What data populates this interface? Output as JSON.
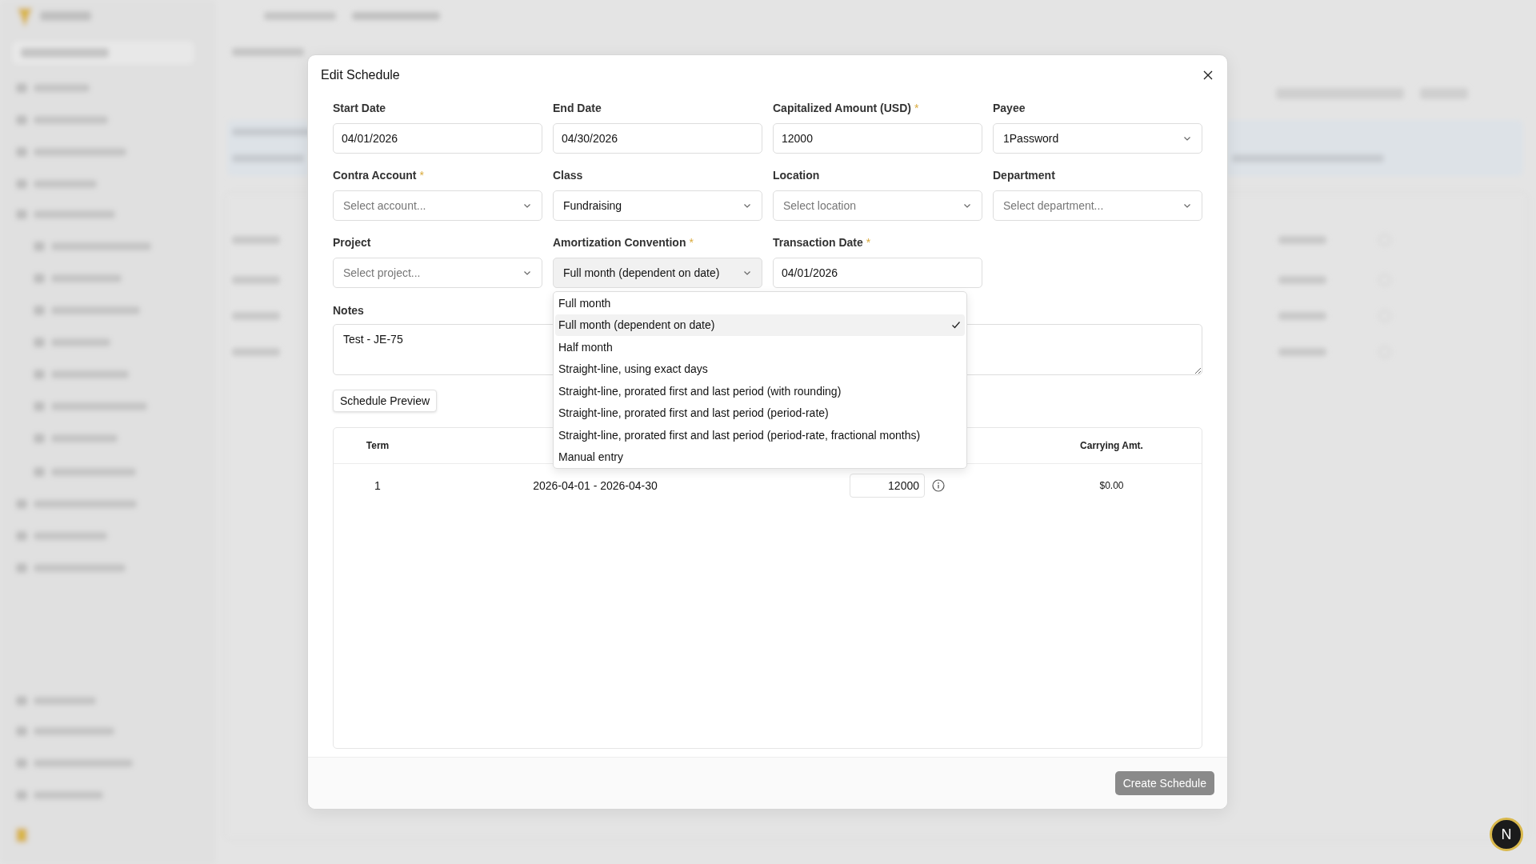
{
  "dialog": {
    "title": "Edit Schedule",
    "fields": [
      {
        "label": "Start Date",
        "kind": "text",
        "value": "04/01/2026"
      },
      {
        "label": "End Date",
        "kind": "text",
        "value": "04/30/2026"
      },
      {
        "label": "Capitalized Amount (USD)",
        "required_mark": "*",
        "kind": "text",
        "value": "12000"
      },
      {
        "label": "Payee",
        "kind": "select",
        "value": "1Password"
      },
      {
        "label": "Contra Account",
        "required_mark": "*",
        "kind": "select",
        "placeholder": "Select account..."
      },
      {
        "label": "Class",
        "kind": "select",
        "value": "Fundraising"
      },
      {
        "label": "Location",
        "kind": "select",
        "placeholder": "Select location"
      },
      {
        "label": "Department",
        "kind": "select",
        "placeholder": "Select department..."
      },
      {
        "label": "Project",
        "kind": "select",
        "placeholder": "Select project..."
      },
      {
        "label": "Amortization Convention",
        "required_mark": "*",
        "kind": "select",
        "value": "Full month (dependent on date)",
        "open": true,
        "options": [
          {
            "label": "Full month",
            "selected": false
          },
          {
            "label": "Full month (dependent on date)",
            "selected": true
          },
          {
            "label": "Half month",
            "selected": false
          },
          {
            "label": "Straight-line, using exact days",
            "selected": false
          },
          {
            "label": "Straight-line, prorated first and last period (with rounding)",
            "selected": false
          },
          {
            "label": "Straight-line, prorated first and last period (period-rate)",
            "selected": false
          },
          {
            "label": "Straight-line, prorated first and last period (period-rate, fractional months)",
            "selected": false
          },
          {
            "label": "Manual entry",
            "selected": false
          }
        ]
      },
      {
        "label": "Transaction Date",
        "required_mark": "*",
        "kind": "text",
        "value": "04/01/2026"
      }
    ],
    "notes": {
      "label": "Notes",
      "value": "Test - JE-75"
    },
    "preview_button": "Schedule Preview",
    "table": {
      "columns": [
        "Term",
        "Carrying Amt."
      ],
      "rows": [
        {
          "term": "1",
          "period": "2026-04-01 - 2026-04-30",
          "amount": "12000",
          "carrying": "$0.00"
        }
      ]
    },
    "submit_button": "Create Schedule"
  },
  "assistant_button": "N"
}
